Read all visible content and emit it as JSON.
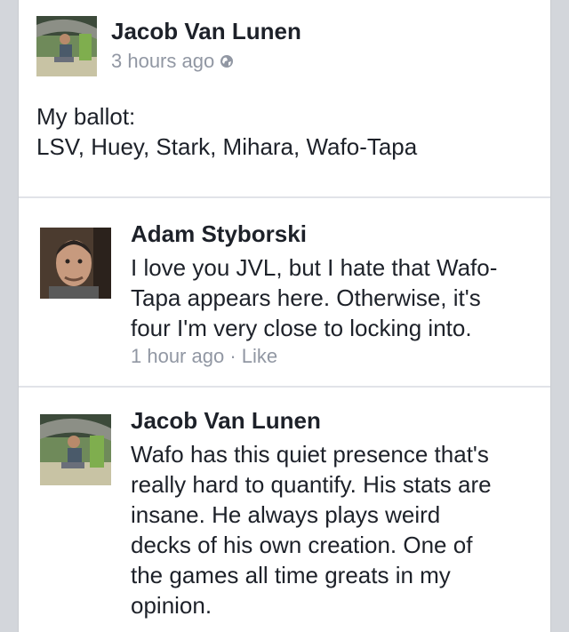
{
  "post": {
    "author": "Jacob Van Lunen",
    "time": "3 hours ago",
    "privacy_icon": "globe-icon",
    "text_lines": [
      "My ballot:",
      "LSV, Huey, Stark, Mihara, Wafo-Tapa"
    ]
  },
  "comments": [
    {
      "author": "Adam Styborski",
      "avatar_icon": "avatar",
      "text_lines": [
        "I love you JVL, but I hate that Wafo-",
        "Tapa appears here. Otherwise, it's",
        "four I'm very close to locking into."
      ],
      "time": "1 hour ago",
      "separator": "·",
      "like_label": "Like"
    },
    {
      "author": "Jacob Van Lunen",
      "avatar_icon": "avatar",
      "text_lines": [
        "Wafo has this quiet presence that's",
        "really hard to quantify. His stats are",
        "insane. He always plays weird",
        "decks of his own creation. One of",
        "the games all time greats in my",
        "opinion."
      ]
    }
  ],
  "colors": {
    "background": "#d3d6db",
    "card": "#ffffff",
    "text": "#1d2129",
    "meta": "#9197a3",
    "divider": "#e1e3e8"
  }
}
